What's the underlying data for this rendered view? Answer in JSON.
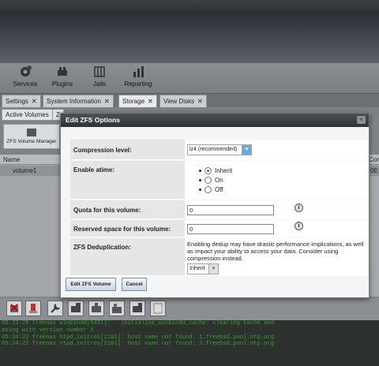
{
  "toolbar": {
    "items": [
      {
        "label": "Services",
        "icon": "services-icon"
      },
      {
        "label": "Plugins",
        "icon": "plugins-icon"
      },
      {
        "label": "Jails",
        "icon": "jails-icon"
      },
      {
        "label": "Reporting",
        "icon": "reporting-icon"
      }
    ]
  },
  "tabs": [
    {
      "label": "Settings",
      "close": "✕"
    },
    {
      "label": "System Information",
      "close": "✕"
    },
    {
      "label": "Storage",
      "close": "✕"
    },
    {
      "label": "View Disks",
      "close": "✕"
    }
  ],
  "subtabs": {
    "active_volumes": "Active Volumes",
    "partial": "Z"
  },
  "volume_manager_label": "ZFS Volume Manager",
  "grid": {
    "header": {
      "name": "Name",
      "partial": "Con"
    },
    "rows": [
      {
        "name": "volume1",
        "partial": ".0E"
      }
    ]
  },
  "console": {
    "lines": [
      "05:23:25 freenas winbindd[6421]:   initialise_winbindd_cache: clearing cache and",
      "ating with version number 2",
      "05:24:22 freenas ntpd_initres[2181]: host name not found: 1.freebsd.pool.ntp.org",
      "05:24:22 freenas ntpd_initres[2181]: host name not found: 2.freebsd.pool.ntp.org"
    ]
  },
  "dialog": {
    "title": "Edit ZFS Options",
    "close": "×",
    "compression": {
      "label": "Compression level:",
      "value": "lz4 (recommended)",
      "arrow": "▾"
    },
    "atime": {
      "label": "Enable atime:",
      "options": [
        {
          "label": "Inherit",
          "selected": true
        },
        {
          "label": "On",
          "selected": false
        },
        {
          "label": "Off",
          "selected": false
        }
      ]
    },
    "quota": {
      "label": "Quota for this volume:",
      "value": "0",
      "help": "i"
    },
    "reserved": {
      "label": "Reserved space for this volume:",
      "value": "0",
      "help": "i"
    },
    "dedup": {
      "label": "ZFS Deduplication:",
      "text": "Enabling dedup may have drastic performance implications, as well as impact your ability to access your data. Consider using compression instead.",
      "value": "Inherit",
      "arrow": "▾"
    },
    "buttons": {
      "edit": "Edit ZFS Volume",
      "cancel": "Cancel"
    }
  }
}
